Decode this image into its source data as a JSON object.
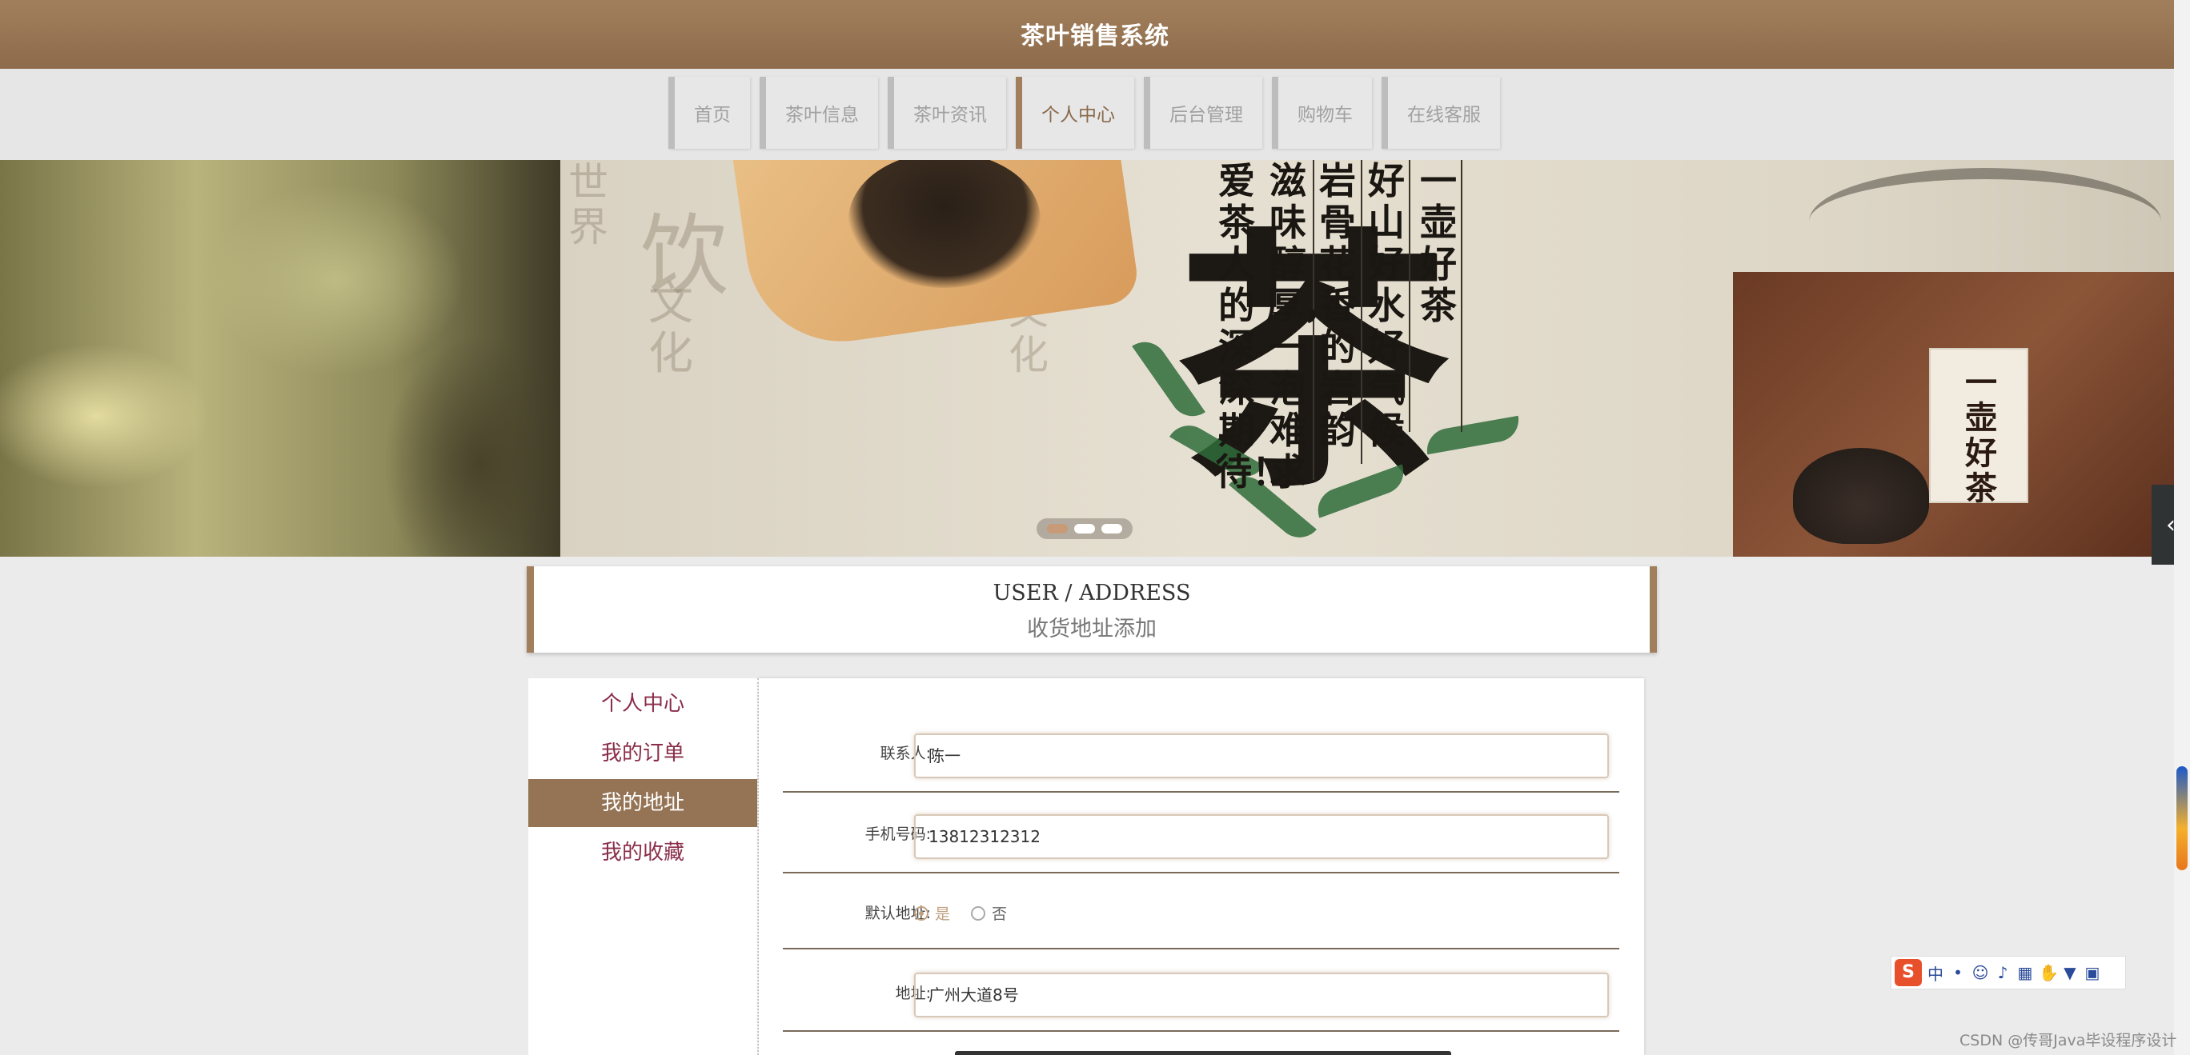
{
  "header": {
    "title": "茶叶销售系统"
  },
  "nav": {
    "items": [
      {
        "label": "首页",
        "active": false
      },
      {
        "label": "茶叶信息",
        "active": false
      },
      {
        "label": "茶叶资讯",
        "active": false
      },
      {
        "label": "个人中心",
        "active": true
      },
      {
        "label": "后台管理",
        "active": false
      },
      {
        "label": "购物车",
        "active": false
      },
      {
        "label": "在线客服",
        "active": false
      }
    ]
  },
  "banner": {
    "big_char": "茶",
    "columns": [
      "一壶好茶",
      "好山好水好气候",
      "岩骨花香的岩韵",
      "滋味醇厚，一泡难求",
      "爱茶人的深深期待！"
    ],
    "label_text": "一壶好茶",
    "slides": 3,
    "active_slide": 0
  },
  "section": {
    "title_en": "USER / ADDRESS",
    "title_zh": "收货地址添加"
  },
  "sidebar": {
    "items": [
      {
        "label": "个人中心",
        "active": false
      },
      {
        "label": "我的订单",
        "active": false
      },
      {
        "label": "我的地址",
        "active": true
      },
      {
        "label": "我的收藏",
        "active": false
      }
    ]
  },
  "form": {
    "contact_label": "联系人:",
    "contact_value": "陈一",
    "phone_label": "手机号码:",
    "phone_value": "13812312312",
    "default_label": "默认地址:",
    "default_yes": "是",
    "default_no": "否",
    "default_selected": "是",
    "address_label": "地址:",
    "address_value": "广州大道8号"
  },
  "ime": {
    "logo": "S",
    "mode": "中",
    "icons": [
      "punctuation-icon",
      "emoji-icon",
      "mic-icon",
      "keyboard-icon",
      "hand-icon",
      "skin-icon",
      "grid-icon"
    ]
  },
  "watermark": "CSDN @传哥Java毕设程序设计",
  "colors": {
    "brand": "#a27f5c",
    "sidebar_active": "#957455",
    "sidebar_text": "#8a2d4a"
  }
}
